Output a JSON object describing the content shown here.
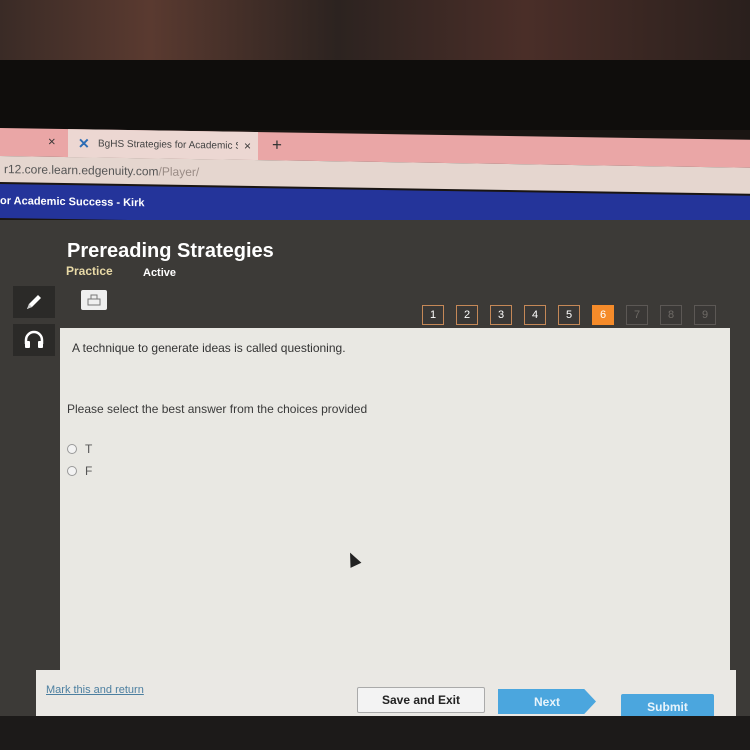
{
  "browser": {
    "tabs": [
      {
        "label": "",
        "close": "×"
      },
      {
        "label": "BgHS Strategies for Academic S",
        "close": "×",
        "icon": "edgenuity-x-icon",
        "active": true
      }
    ],
    "new_tab": "+",
    "url_host": "r12.core.learn.edgenuity.com",
    "url_path": "/Player/"
  },
  "header": {
    "course_title": "or Academic Success - Kirk"
  },
  "lesson": {
    "title": "Prereading Strategies",
    "type": "Practice",
    "status": "Active"
  },
  "tools": {
    "pencil": "pencil-icon",
    "audio": "headphones-icon",
    "print": "printer-icon"
  },
  "question_nav": [
    {
      "label": "1",
      "state": "answered"
    },
    {
      "label": "2",
      "state": "answered"
    },
    {
      "label": "3",
      "state": "answered"
    },
    {
      "label": "4",
      "state": "answered"
    },
    {
      "label": "5",
      "state": "answered"
    },
    {
      "label": "6",
      "state": "current"
    },
    {
      "label": "7",
      "state": "locked"
    },
    {
      "label": "8",
      "state": "locked"
    },
    {
      "label": "9",
      "state": "locked"
    }
  ],
  "question": {
    "text": "A technique to generate ideas is called questioning.",
    "instructions": "Please select the best answer from the choices provided",
    "choices": [
      {
        "label": "T",
        "selected": false
      },
      {
        "label": "F",
        "selected": false
      }
    ]
  },
  "footer": {
    "mark_link": "Mark this and return",
    "save_exit": "Save and Exit",
    "next": "Next",
    "submit": "Submit"
  },
  "colors": {
    "header_blue": "#24349a",
    "current_question": "#f58b2a",
    "answered_border": "#c58857",
    "action_blue": "#4ba6de"
  }
}
